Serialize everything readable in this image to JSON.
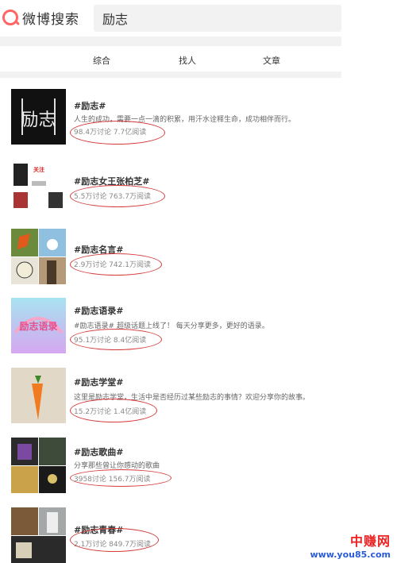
{
  "app": {
    "logo_text": "微博搜索"
  },
  "search": {
    "value": "励志"
  },
  "tabs": [
    {
      "label": "综合"
    },
    {
      "label": "找人"
    },
    {
      "label": "文章"
    }
  ],
  "topics": [
    {
      "title": "#励志#",
      "desc": "人生的成功，需要一点一滴的积累，用汗水诠释生命，成功相伴而行。",
      "stats": "98.4万讨论 7.7亿阅读",
      "thumb_text": "励志"
    },
    {
      "title": "#励志女王张柏芝#",
      "desc": "",
      "stats": "5.5万讨论 763.7万阅读",
      "thumb_text": "关注"
    },
    {
      "title": "#励志名言#",
      "desc": "",
      "stats": "2.9万讨论 742.1万阅读",
      "thumb_text": ""
    },
    {
      "title": "#励志语录#",
      "desc": "#励志语录# 超级话题上线了！ 每天分享更多，更好的语录。",
      "stats": "95.1万讨论 8.4亿阅读",
      "thumb_text": "励志语录"
    },
    {
      "title": "#励志学堂#",
      "desc": "这里是励志学堂，生活中是否经历过某些励志的事情？欢迎分享你的故事。",
      "stats": "15.2万讨论 1.4亿阅读",
      "thumb_text": ""
    },
    {
      "title": "#励志歌曲#",
      "desc": "分享那些曾让你感动的歌曲",
      "stats": "3958讨论 156.7万阅读",
      "thumb_text": ""
    },
    {
      "title": "#励志青春#",
      "desc": "",
      "stats": "2.1万讨论 849.7万阅读",
      "thumb_text": ""
    }
  ],
  "watermark": {
    "text": "中赚网",
    "url": "www.you85.com"
  },
  "colors": {
    "accent": "#ff6666",
    "annotation": "#d43b3b",
    "watermark_red": "#ee2222",
    "watermark_blue": "#2a5bd7"
  }
}
